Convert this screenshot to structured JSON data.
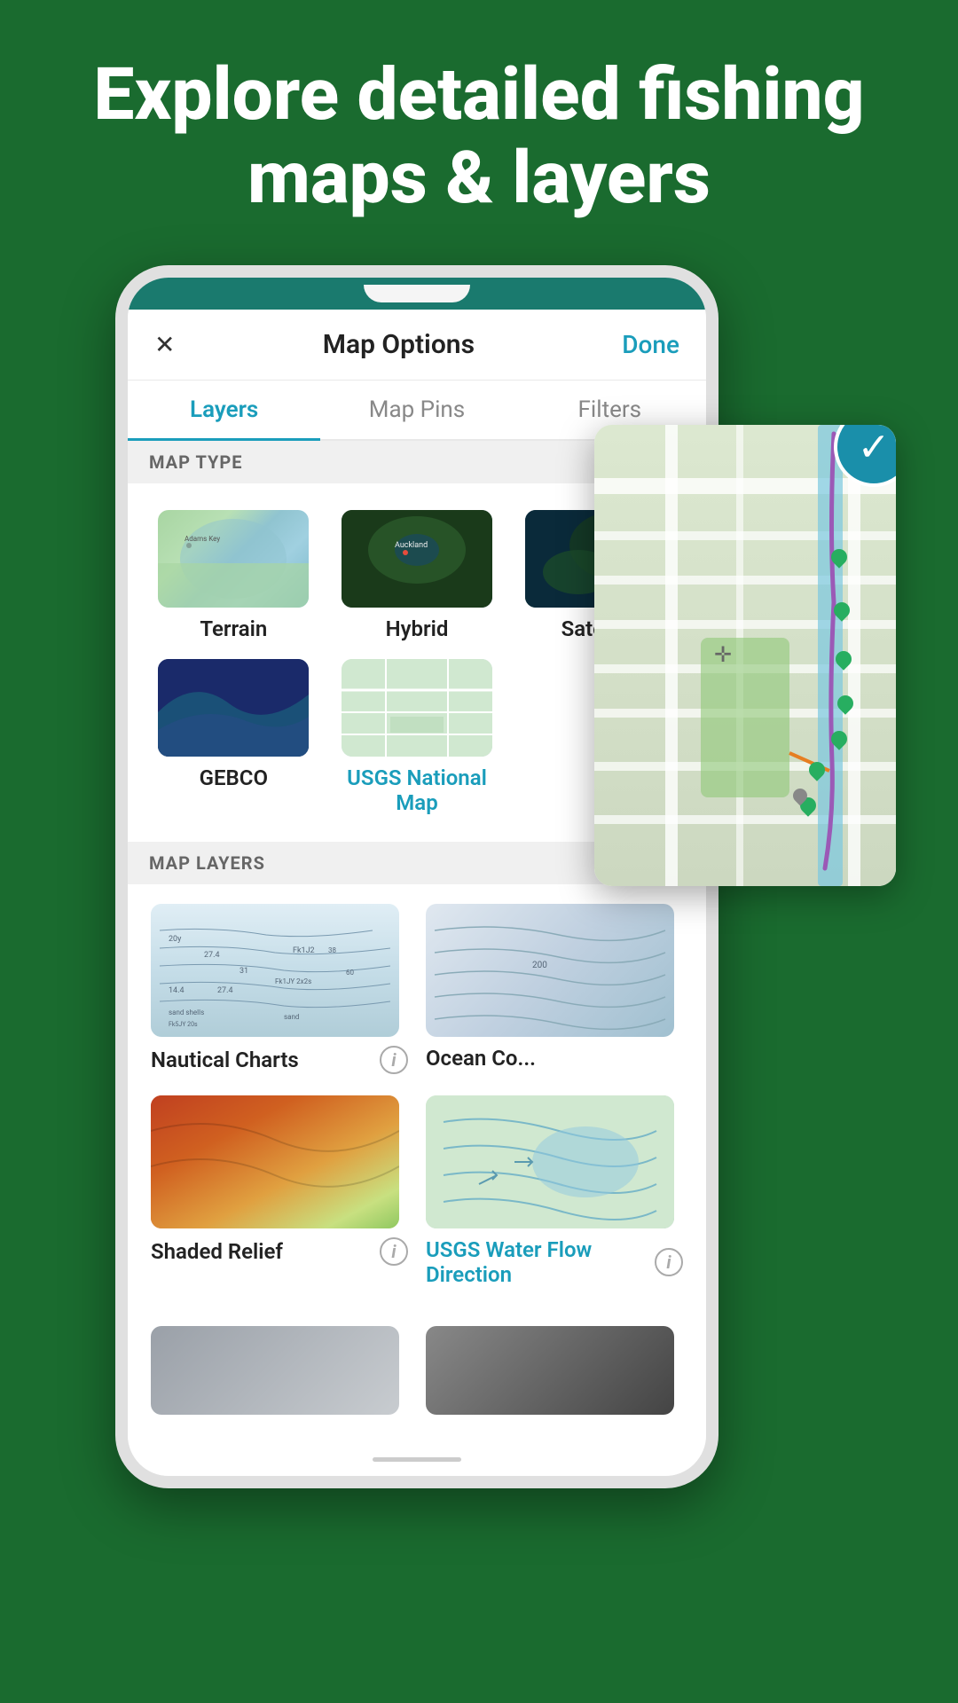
{
  "page": {
    "hero_title": "Explore detailed fishing maps & layers",
    "background_color": "#1a6b2f"
  },
  "header": {
    "close_label": "✕",
    "title": "Map Options",
    "done_label": "Done"
  },
  "tabs": [
    {
      "id": "layers",
      "label": "Layers",
      "active": true
    },
    {
      "id": "map-pins",
      "label": "Map Pins",
      "active": false
    },
    {
      "id": "filters",
      "label": "Filters",
      "active": false
    }
  ],
  "map_type_section": {
    "label": "MAP TYPE",
    "items": [
      {
        "id": "terrain",
        "label": "Terrain",
        "selected": false
      },
      {
        "id": "hybrid",
        "label": "Hybrid",
        "selected": false
      },
      {
        "id": "satellite",
        "label": "Satellite",
        "selected": false
      },
      {
        "id": "gebco",
        "label": "GEBCO",
        "selected": false
      },
      {
        "id": "usgs",
        "label": "USGS National Map",
        "selected": true
      }
    ]
  },
  "map_layers_section": {
    "label": "MAP LAYERS",
    "items": [
      {
        "id": "nautical",
        "label": "Nautical Charts",
        "selected": false,
        "has_info": true
      },
      {
        "id": "ocean",
        "label": "Ocean Co...",
        "selected": false,
        "has_info": false
      },
      {
        "id": "shaded",
        "label": "Shaded Relief",
        "selected": false,
        "has_info": true
      },
      {
        "id": "usgs-water",
        "label": "USGS Water Flow Direction",
        "selected": true,
        "has_info": true
      }
    ]
  },
  "icons": {
    "check": "✓",
    "close": "✕",
    "info": "i"
  }
}
